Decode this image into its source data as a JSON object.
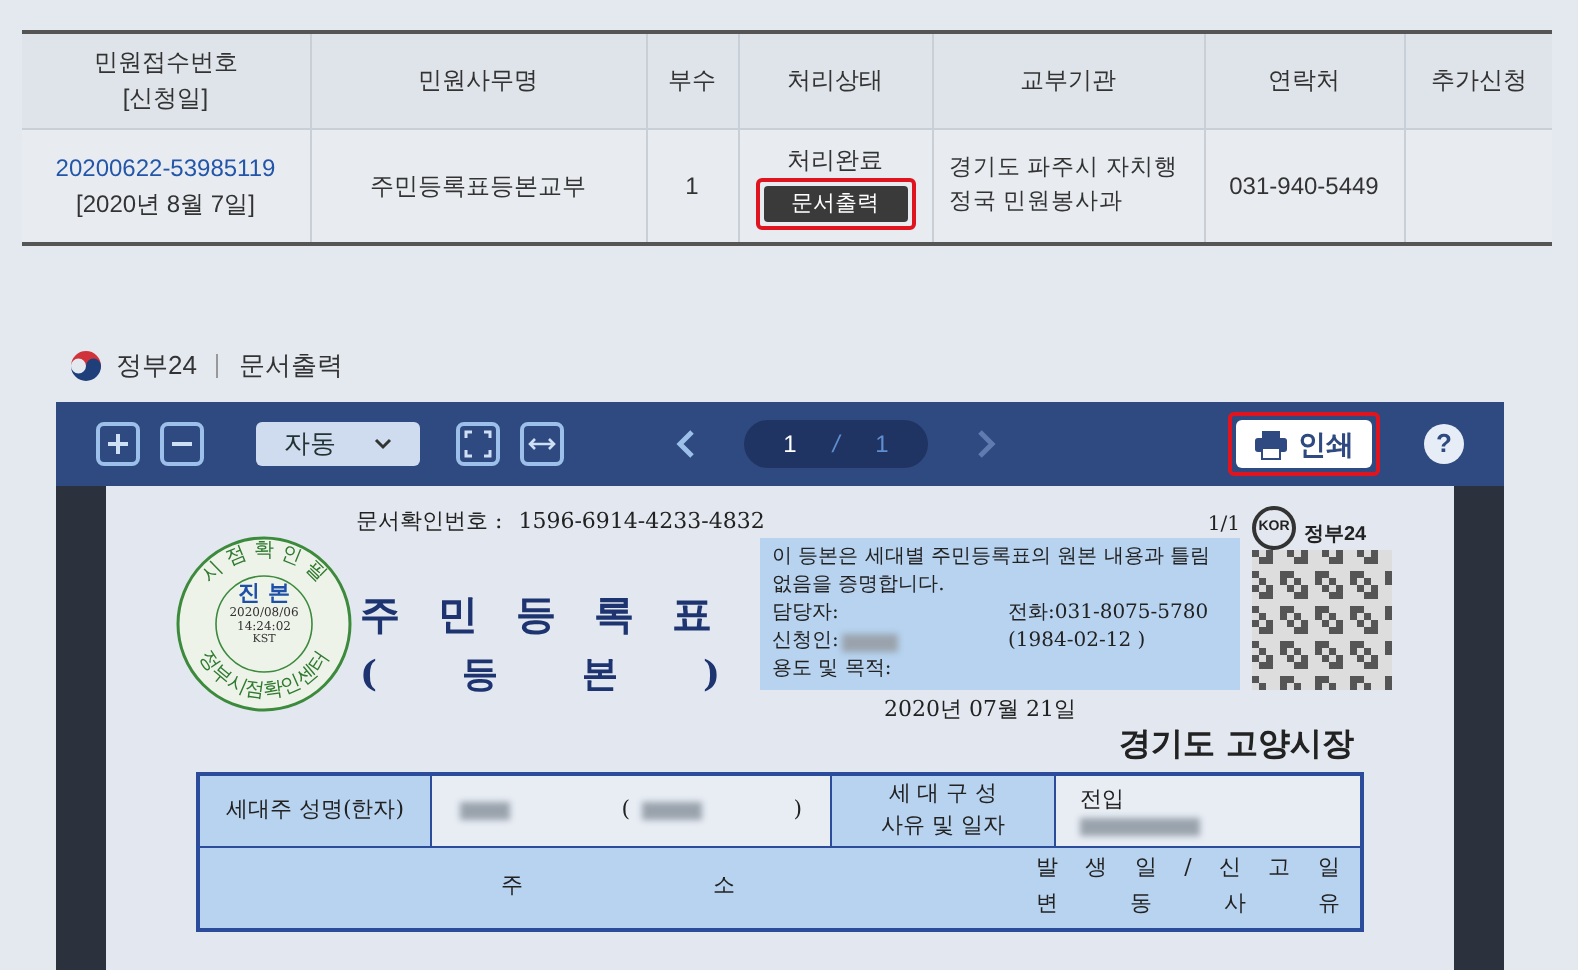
{
  "applications_table": {
    "columns": [
      {
        "lines": [
          "민원접수번호",
          "[신청일]"
        ]
      },
      {
        "lines": [
          "민원사무명"
        ]
      },
      {
        "lines": [
          "부수"
        ]
      },
      {
        "lines": [
          "처리상태"
        ]
      },
      {
        "lines": [
          "교부기관"
        ]
      },
      {
        "lines": [
          "연락처"
        ]
      },
      {
        "lines": [
          "추가신청"
        ]
      }
    ],
    "rows": [
      {
        "receipt_number": "20200622-53985119",
        "date": "[2020년 8월 7일]",
        "service": "주민등록표등본교부",
        "copies": "1",
        "status": "처리완료",
        "print_button": {
          "label": "문서출력",
          "highlighted": true
        },
        "agency": "경기도 파주시 자치행정국 민원봉사과",
        "contact": "031-940-5449"
      }
    ]
  },
  "viewer": {
    "brand": "정부24",
    "title": "문서출력",
    "toolbar": {
      "zoom": "자동",
      "page_current": "1",
      "page_separator": "/",
      "page_total": "1",
      "prev_disabled": false,
      "next_disabled": true,
      "print": {
        "label": "인쇄",
        "highlighted": true
      },
      "help": "?"
    },
    "document": {
      "confirm_label": "문서확인번호 :",
      "confirm_number": "1596-6914-4233-4832",
      "page": "1/1",
      "stamp": {
        "top": "시 점 확 인 필",
        "center": "진 본",
        "date": "2020/08/06",
        "time": "14:24:02",
        "zone": "KST",
        "bottom": "정부시점확인센터"
      },
      "title": "주 민 등 록 표",
      "subtitle": [
        "(",
        "등",
        "본",
        ")"
      ],
      "notice": "이 등본은 세대별 주민등록표의 원본 내용과 틀림없음을 증명합니다.",
      "notice_fields": [
        {
          "label": "담당자:",
          "value": "전화:031-8075-5780"
        },
        {
          "label": "신청인:",
          "value": "(1984-02-12 )",
          "blurred": true
        },
        {
          "label": "용도 및 목적:"
        }
      ],
      "qr_badge": "KOR",
      "qr_label": "정부24",
      "date": "2020년 07월 21일",
      "issuer": "경기도 고양시장",
      "household": {
        "name_label": "세대주 성명(한자)",
        "open_paren": "(",
        "close_paren": ")",
        "reason_label": [
          "세 대 구 성",
          "사유 및 일자"
        ],
        "reason_value": "전입"
      },
      "address_header": {
        "left": [
          "주",
          "소"
        ],
        "right_top": [
          "발",
          "생",
          "일",
          "/",
          "신",
          "고",
          "일"
        ],
        "right_bottom": [
          "변",
          "동",
          "사",
          "유"
        ]
      }
    }
  }
}
